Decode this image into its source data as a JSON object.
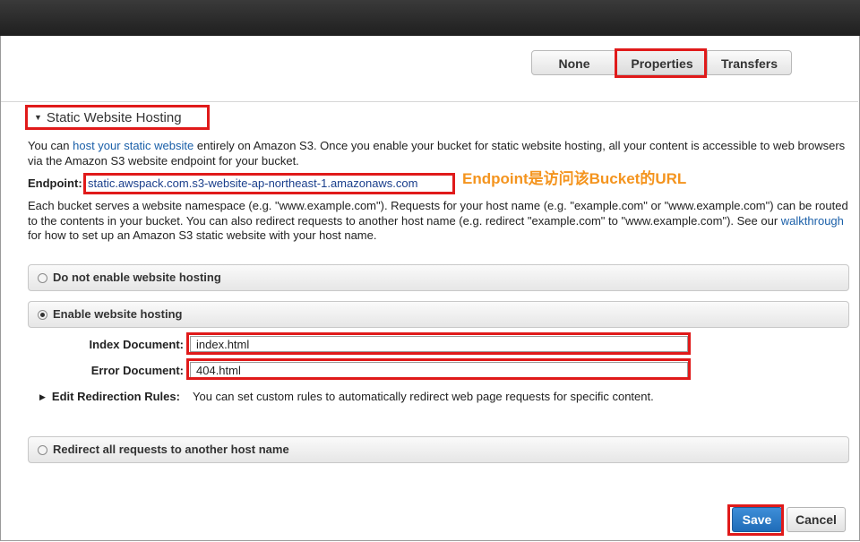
{
  "tabs": [
    {
      "label": "None"
    },
    {
      "label": "Properties"
    },
    {
      "label": "Transfers"
    }
  ],
  "section": {
    "title": "Static Website Hosting"
  },
  "intro": {
    "pre": "You can ",
    "link": "host your static website",
    "post": " entirely on Amazon S3. Once you enable your bucket for static website hosting, all your content is accessible to web browsers via the Amazon S3 website endpoint for your bucket."
  },
  "endpoint": {
    "label": "Endpoint:",
    "url": "static.awspack.com.s3-website-ap-northeast-1.amazonaws.com",
    "annotation": "Endpoint是访问该Bucket的URL"
  },
  "namespace": {
    "pre": "Each bucket serves a website namespace (e.g. \"www.example.com\"). Requests for your host name (e.g. \"example.com\" or \"www.example.com\") can be routed to the contents in your bucket. You can also redirect requests to another host name (e.g. redirect \"example.com\" to \"www.example.com\"). See our ",
    "link": "walkthrough",
    "post": " for how to set up an Amazon S3 static website with your host name."
  },
  "options": {
    "disable": "Do not enable website hosting",
    "enable": "Enable website hosting",
    "redirect": "Redirect all requests to another host name"
  },
  "fields": {
    "index_label": "Index Document:",
    "index_value": "index.html",
    "error_label": "Error Document:",
    "error_value": "404.html"
  },
  "redirection": {
    "label": "Edit Redirection Rules:",
    "text": "You can set custom rules to automatically redirect web page requests for specific content."
  },
  "buttons": {
    "save": "Save",
    "cancel": "Cancel"
  },
  "colors": {
    "highlight": "#e01a1a",
    "annotation": "#f4941e",
    "link": "#1a5fa8"
  }
}
